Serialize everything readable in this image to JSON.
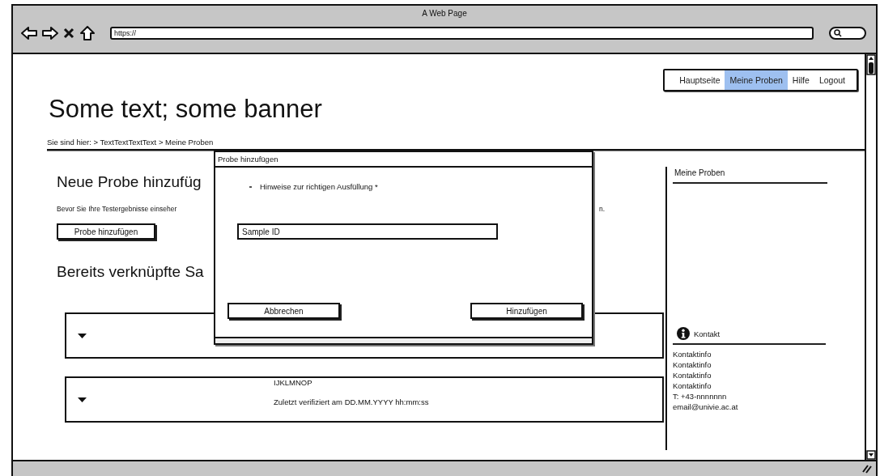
{
  "window": {
    "title": "A Web Page"
  },
  "address_bar": {
    "value": "https://"
  },
  "nav": [
    {
      "label": "Hauptseite",
      "selected": false
    },
    {
      "label": "Meine Proben",
      "selected": true
    },
    {
      "label": "Hilfe",
      "selected": false
    },
    {
      "label": "Logout",
      "selected": false
    }
  ],
  "banner": "Some text; some banner",
  "breadcrumb": "Sie sind hier: > TextTextTextText > Meine Proben",
  "main": {
    "heading": "Neue Probe hinzufüg",
    "intro": [
      "Bevor Sie Ihre Testergebnisse einseher",
      "n."
    ],
    "add_button": "Probe hinzufügen",
    "linked_heading": "Bereits verknüpfte Sa",
    "samples": [
      {
        "kind": "blank"
      },
      {
        "kind": "summary",
        "id": "IJKLMNOP",
        "verified": "Zuletzt verifiziert am DD.MM.YYYY hh:mm:ss"
      }
    ]
  },
  "sidebar": {
    "title": "Meine Proben",
    "contact_title": "Kontakt",
    "contact_lines": [
      "Kontaktinfo",
      "Kontaktinfo",
      "Kontaktinfo",
      "Kontaktinfo",
      "T: +43-nnnnnnn",
      "email@univie.ac.at"
    ]
  },
  "dialog": {
    "title": "Probe hinzufügen",
    "hint": "Hinweise zur richtigen Ausfüllung *",
    "field": {
      "value": "Sample ID"
    },
    "buttons": [
      "Abbrechen",
      "Hinzufügen"
    ]
  }
}
